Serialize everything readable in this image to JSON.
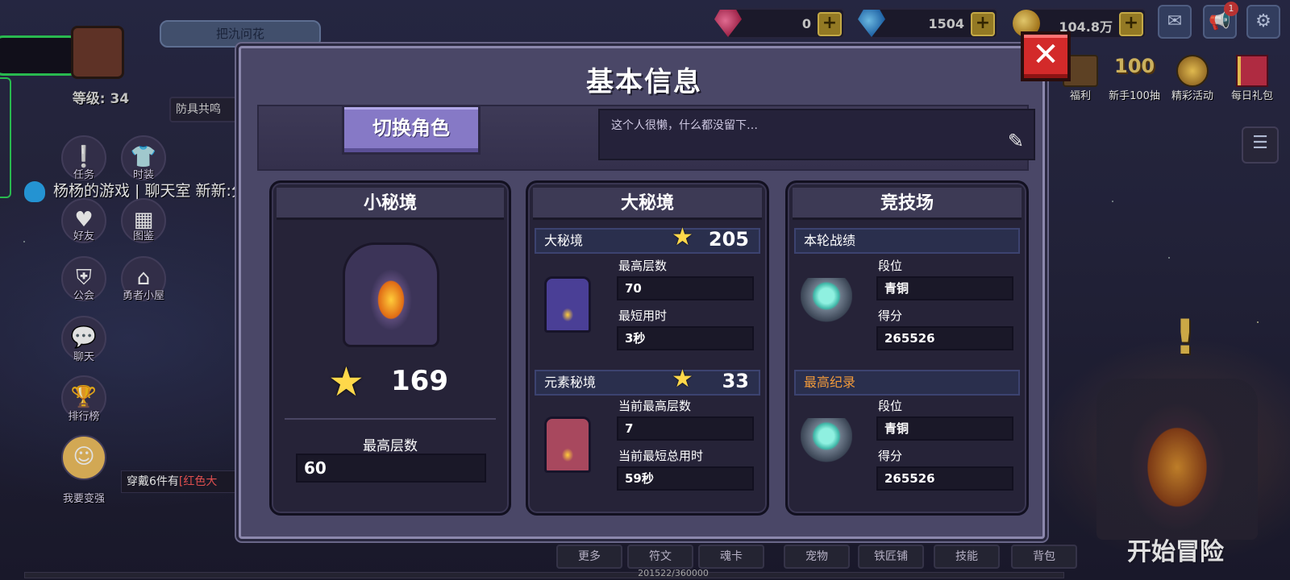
{
  "top_bar": {
    "player_name": "把氿问花",
    "gems_pink": "0",
    "gems_blue": "1504",
    "gold": "104.8万",
    "plus": "+",
    "notification_count": "1"
  },
  "left_hud": {
    "level": "等级: 34",
    "notice": "防具共鸣",
    "chat_line": "杨杨的游戏 | 聊天室  新新:分享",
    "buttons": [
      "任务",
      "时装",
      "好友",
      "图鉴",
      "公会",
      "勇者小屋",
      "聊天",
      "排行榜",
      "我要变强"
    ],
    "tip": "穿戴6件有",
    "tip_red": "[红色大"
  },
  "right_hud": {
    "buttons": [
      "福利",
      "新手100抽",
      "精彩活动",
      "每日礼包"
    ],
    "start": "开始冒险"
  },
  "bottom_nav": {
    "items": [
      "更多",
      "符文",
      "魂卡",
      "宠物",
      "铁匠铺",
      "技能",
      "背包"
    ],
    "exp": "201522/360000"
  },
  "modal": {
    "title": "基本信息",
    "close": "✕",
    "switch_role": "切换角色",
    "signature": "这个人很懒，什么都没留下…",
    "small_realm": {
      "title": "小秘境",
      "stars": "169",
      "max_floor_label": "最高层数",
      "max_floor": "60"
    },
    "big_realm": {
      "title": "大秘境",
      "sec1_label": "大秘境",
      "sec1_stars": "205",
      "max_floor_label": "最高层数",
      "max_floor": "70",
      "min_time_label": "最短用时",
      "min_time": "3秒",
      "sec2_label": "元素秘境",
      "sec2_stars": "33",
      "cur_floor_label": "当前最高层数",
      "cur_floor": "7",
      "cur_time_label": "当前最短总用时",
      "cur_time": "59秒"
    },
    "arena": {
      "title": "竞技场",
      "sec1_label": "本轮战绩",
      "rank_label": "段位",
      "rank": "青铜",
      "score_label": "得分",
      "score": "265526",
      "sec2_label": "最高纪录",
      "best_rank_label": "段位",
      "best_rank": "青铜",
      "best_score_label": "得分",
      "best_score": "265526"
    }
  },
  "colors": {
    "accent_purple": "#8679c6",
    "close_red": "#d32a2a",
    "record_orange": "#f29a3a",
    "star_yellow": "#ffd84a"
  }
}
